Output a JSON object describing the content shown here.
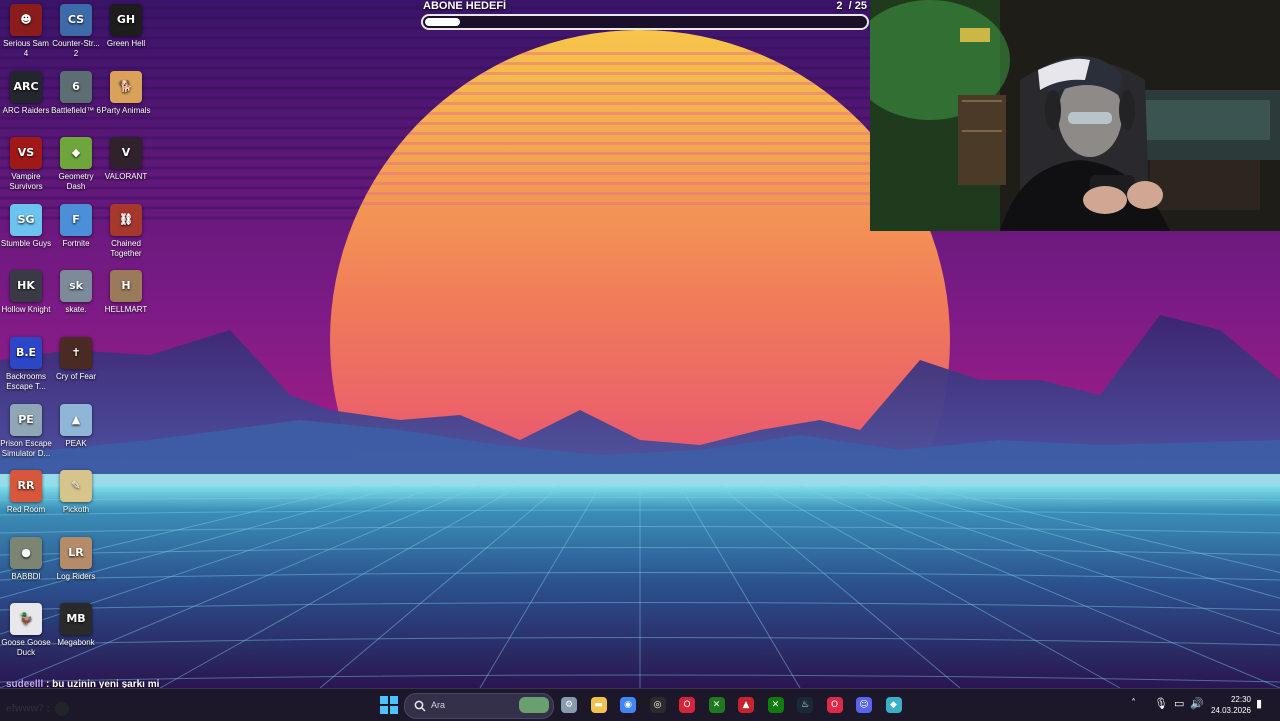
{
  "goal": {
    "title": "ABONE HEDEFİ",
    "current": "2",
    "target": "/ 25",
    "progress_fraction": 0.08
  },
  "desktop_icons": [
    {
      "label": "Serious Sam 4",
      "color": "#8a1c1c",
      "glyph": "☻"
    },
    {
      "label": "Counter-Str... 2",
      "color": "#3d6aa8",
      "glyph": "CS"
    },
    {
      "label": "Green Hell",
      "color": "#1d1d1d",
      "glyph": "GH"
    },
    {
      "label": "ARC Raiders",
      "color": "#23262d",
      "glyph": "ARC"
    },
    {
      "label": "Battlefield™ 6",
      "color": "#5c6d73",
      "glyph": "6"
    },
    {
      "label": "Party Animals",
      "color": "#d9a15a",
      "glyph": "🐕"
    },
    {
      "label": "Vampire Survivors",
      "color": "#a01818",
      "glyph": "VS"
    },
    {
      "label": "Geometry Dash",
      "color": "#6fa63c",
      "glyph": "◆"
    },
    {
      "label": "VALORANT",
      "color": "#30222c",
      "glyph": "V"
    },
    {
      "label": "Stumble Guys",
      "color": "#6bc3f0",
      "glyph": "SG"
    },
    {
      "label": "Fortnite",
      "color": "#4a8fd8",
      "glyph": "F"
    },
    {
      "label": "Chained Together",
      "color": "#a5372d",
      "glyph": "⛓"
    },
    {
      "label": "Hollow Knight",
      "color": "#3a3a46",
      "glyph": "HK"
    },
    {
      "label": "skate.",
      "color": "#7c8a9a",
      "glyph": "sk"
    },
    {
      "label": "HELLMART",
      "color": "#9b7a5c",
      "glyph": "H"
    },
    {
      "label": "Backrooms Escape T...",
      "color": "#2c46c8",
      "glyph": "B.E"
    },
    {
      "label": "Cry of Fear",
      "color": "#4a2a22",
      "glyph": "✝"
    },
    {
      "label": "Prison Escape Simulator D...",
      "color": "#8fa6b6",
      "glyph": "PE"
    },
    {
      "label": "PEAK",
      "color": "#8fb6d6",
      "glyph": "▲"
    },
    {
      "label": "Red Room",
      "color": "#d8573c",
      "glyph": "RR"
    },
    {
      "label": "Pickoth",
      "color": "#d6c48a",
      "glyph": "✎"
    },
    {
      "label": "BABBDI",
      "color": "#7c8474",
      "glyph": "●"
    },
    {
      "label": "Log Riders",
      "color": "#b58c6a",
      "glyph": "LR"
    },
    {
      "label": "Goose Goose Duck",
      "color": "#e8e8ec",
      "glyph": "🦆"
    },
    {
      "label": "Megabonk",
      "color": "#2a2a2a",
      "glyph": "MB"
    }
  ],
  "chat": [
    {
      "user": "sudeelll",
      "message": ": bu uzinin yeni şarkı mi"
    },
    {
      "user": "efwww7",
      "message": ":"
    }
  ],
  "taskbar": {
    "search_placeholder": "Ara",
    "apps": [
      {
        "name": "settings-icon",
        "color": "#8a9bb0",
        "glyph": "⚙"
      },
      {
        "name": "file-explorer-icon",
        "color": "#f2c14e",
        "glyph": "▬"
      },
      {
        "name": "chrome-icon",
        "color": "#4285f4",
        "glyph": "◉"
      },
      {
        "name": "obs-icon",
        "color": "#2b2b2b",
        "glyph": "◎"
      },
      {
        "name": "opera-icon",
        "color": "#d6243a",
        "glyph": "O"
      },
      {
        "name": "xbox-app-icon",
        "color": "#1f7a1f",
        "glyph": "✕"
      },
      {
        "name": "game-launcher-icon",
        "color": "#c8232c",
        "glyph": "▲"
      },
      {
        "name": "xbox-icon",
        "color": "#107c10",
        "glyph": "✕"
      },
      {
        "name": "steam-icon",
        "color": "#1b2838",
        "glyph": "♨"
      },
      {
        "name": "opera-gx-icon",
        "color": "#e0284a",
        "glyph": "O"
      },
      {
        "name": "discord-icon",
        "color": "#5865f2",
        "glyph": "☺"
      },
      {
        "name": "network-app-icon",
        "color": "#3ab0c8",
        "glyph": "◆"
      }
    ],
    "time": "22:30",
    "date": "24.03.2026"
  },
  "colors": {
    "sky_top": "#3a1468",
    "sun_top": "#f6c64a",
    "sun_bottom": "#e02e8a",
    "grid_line": "#7fd0e8"
  }
}
